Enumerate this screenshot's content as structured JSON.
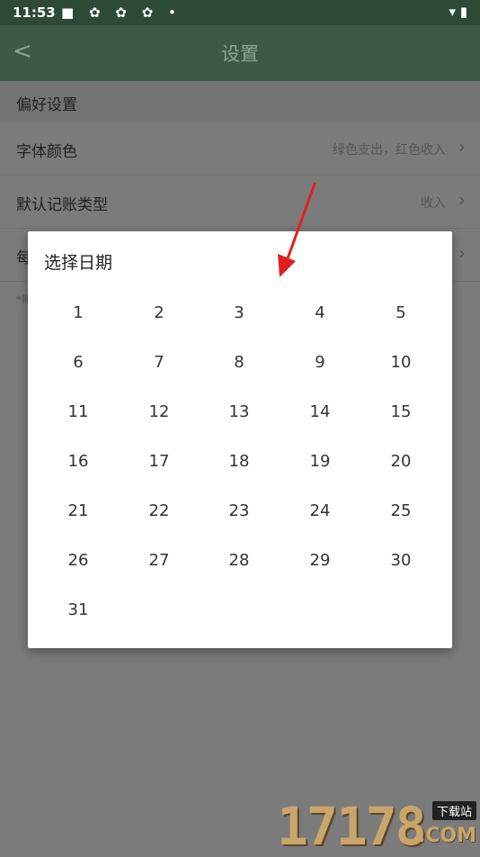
{
  "status": {
    "time": "11:53",
    "icons": "■ ✿ ✿ ✿ •",
    "right": "▾ ▮"
  },
  "appbar": {
    "back": "<",
    "title": "设置"
  },
  "section": {
    "title": "偏好设置"
  },
  "rows": [
    {
      "label": "字体颜色",
      "value": "绿色支出，红色收入"
    },
    {
      "label": "默认记账类型",
      "value": "收入"
    },
    {
      "label": "每",
      "value": ""
    }
  ],
  "footnote": "*账",
  "dialog": {
    "title": "选择日期",
    "days": [
      "1",
      "2",
      "3",
      "4",
      "5",
      "6",
      "7",
      "8",
      "9",
      "10",
      "11",
      "12",
      "13",
      "14",
      "15",
      "16",
      "17",
      "18",
      "19",
      "20",
      "21",
      "22",
      "23",
      "24",
      "25",
      "26",
      "27",
      "28",
      "29",
      "30",
      "31"
    ]
  },
  "colors": {
    "appbar": "#3c5a46",
    "arrow": "#e02020",
    "accent": "#c9a56c"
  },
  "watermark": {
    "digits": "17178",
    "tag": "下载站",
    "com": ".COM"
  }
}
